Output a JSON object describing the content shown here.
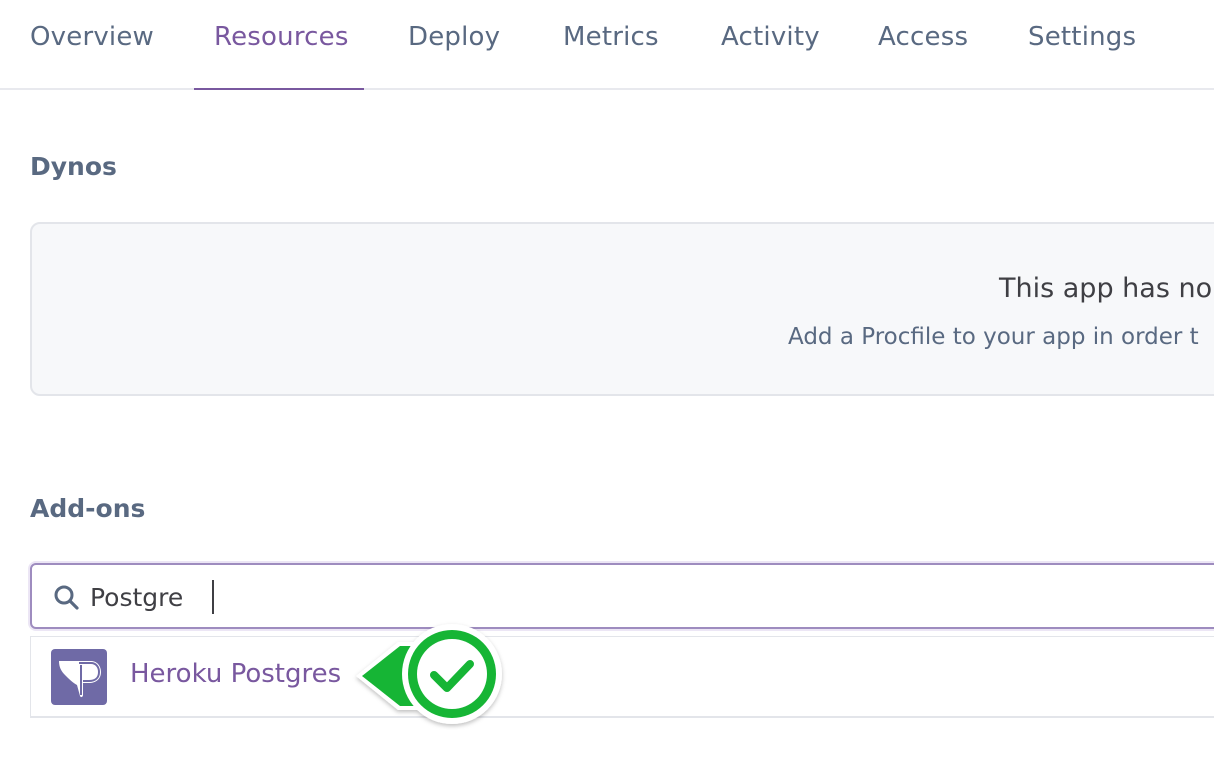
{
  "nav": {
    "tabs": [
      {
        "label": "Overview"
      },
      {
        "label": "Resources",
        "active": true
      },
      {
        "label": "Deploy"
      },
      {
        "label": "Metrics"
      },
      {
        "label": "Activity"
      },
      {
        "label": "Access"
      },
      {
        "label": "Settings"
      }
    ]
  },
  "dynos": {
    "heading": "Dynos",
    "empty_title": "This app has no",
    "empty_subtitle": "Add a Procfile to your app in order t"
  },
  "addons": {
    "heading": "Add-ons",
    "search": {
      "value": "Postgre",
      "icon": "search-icon"
    },
    "results": [
      {
        "label": "Heroku Postgres",
        "icon": "heroku-postgres-logo-icon"
      }
    ]
  },
  "callout": {
    "icon": "green-checkmark-icon",
    "color": "#12b534"
  },
  "colors": {
    "accent": "#79589f",
    "muted_text": "#596981",
    "border": "#e3e5ea"
  }
}
